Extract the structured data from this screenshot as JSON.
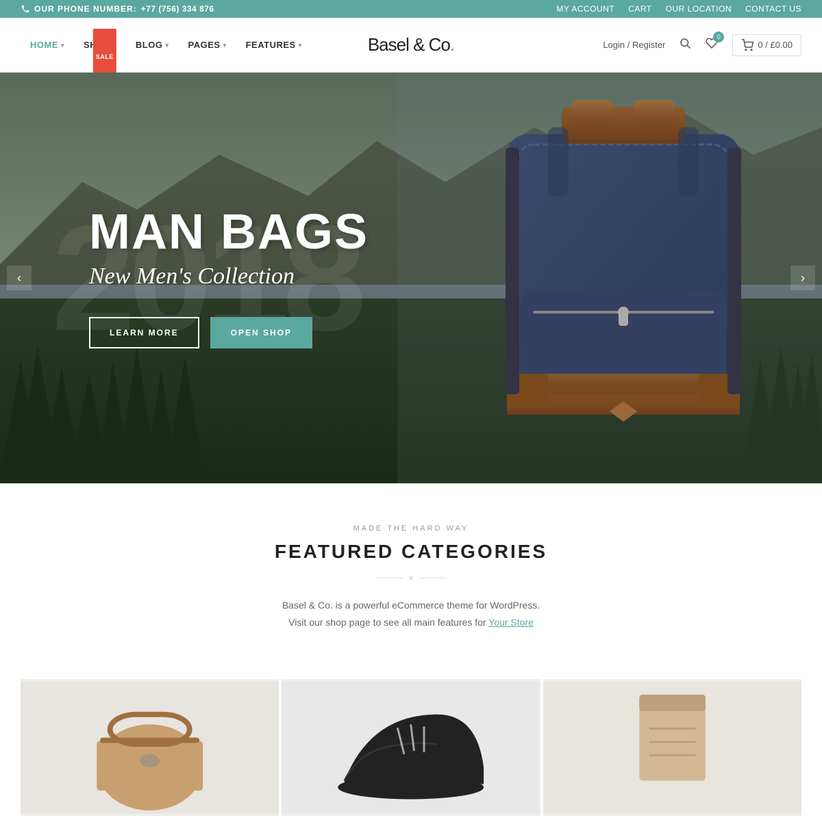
{
  "topbar": {
    "phone_label": "OUR PHONE NUMBER:",
    "phone_number": "+77 (756) 334 876",
    "my_account": "MY ACCOUNT",
    "cart": "CART",
    "our_location": "OUR LOCATION",
    "contact_us": "CONTACT US"
  },
  "nav": {
    "logo": "Basel & Co.",
    "items": [
      {
        "label": "HOME",
        "has_dropdown": true,
        "active": true
      },
      {
        "label": "SHOP",
        "has_dropdown": true,
        "active": false,
        "badge": "SALE"
      },
      {
        "label": "BLOG",
        "has_dropdown": true,
        "active": false
      },
      {
        "label": "PAGES",
        "has_dropdown": true,
        "active": false
      },
      {
        "label": "FEATURES",
        "has_dropdown": true,
        "active": false
      }
    ],
    "login_register": "Login / Register",
    "cart_text": "0 / £0.00",
    "wishlist_count": "0"
  },
  "hero": {
    "year_watermark": "2018",
    "title": "MAN BAGS",
    "subtitle": "New Men's Collection",
    "btn_learn": "LEARN MORE",
    "btn_shop": "OPEN SHOP"
  },
  "featured": {
    "eyebrow": "MADE THE HARD WAY",
    "title": "FEATURED CATEGORIES",
    "divider_symbol": "×",
    "description_line1": "Basel & Co. is a powerful eCommerce theme for WordPress.",
    "description_line2": "Visit our shop page to see all main features for ",
    "link_text": "Your Store"
  }
}
